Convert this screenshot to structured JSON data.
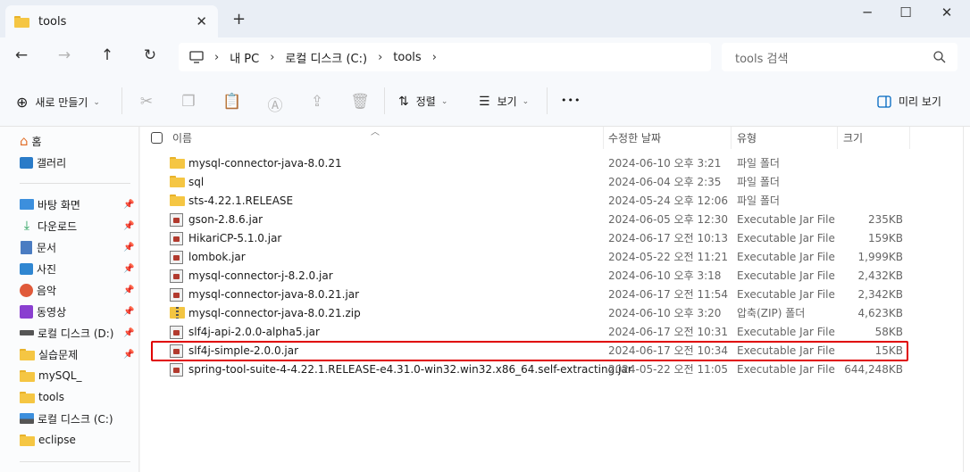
{
  "tab": {
    "title": "tools",
    "close": "✕",
    "new_tab": "+"
  },
  "window": {
    "minimize": "─",
    "maximize": "☐",
    "close": "✕"
  },
  "nav": {
    "breadcrumbs": [
      "내 PC",
      "로컬 디스크 (C:)",
      "tools"
    ],
    "search_placeholder": "tools 검색"
  },
  "commands": {
    "new": "새로 만들기",
    "sort": "정렬",
    "view": "보기",
    "more": "•••",
    "preview": "미리 보기"
  },
  "sidebar": {
    "top": [
      {
        "label": "홈",
        "icon": "home-icon"
      },
      {
        "label": "갤러리",
        "icon": "gallery-icon"
      }
    ],
    "quick": [
      {
        "label": "바탕 화면",
        "icon": "desktop-icon",
        "pinned": true
      },
      {
        "label": "다운로드",
        "icon": "download-icon",
        "pinned": true
      },
      {
        "label": "문서",
        "icon": "document-icon",
        "pinned": true
      },
      {
        "label": "사진",
        "icon": "pictures-icon",
        "pinned": true
      },
      {
        "label": "음악",
        "icon": "music-icon",
        "pinned": true
      },
      {
        "label": "동영상",
        "icon": "video-icon",
        "pinned": true
      },
      {
        "label": "로컬 디스크 (D:)",
        "icon": "drive-icon",
        "pinned": true
      },
      {
        "label": "실습문제",
        "icon": "folder-icon",
        "pinned": true
      },
      {
        "label": "mySQL_",
        "icon": "folder-icon",
        "pinned": false
      },
      {
        "label": "tools",
        "icon": "folder-icon",
        "pinned": false
      },
      {
        "label": "로컬 디스크 (C:)",
        "icon": "drive-icon",
        "pinned": false
      },
      {
        "label": "eclipse",
        "icon": "folder-icon",
        "pinned": false
      }
    ]
  },
  "columns": {
    "name": "이름",
    "modified": "수정한 날짜",
    "type": "유형",
    "size": "크기"
  },
  "files": [
    {
      "name": "mysql-connector-java-8.0.21",
      "date": "2024-06-10 오후 3:21",
      "type": "파일 폴더",
      "size": "",
      "kind": "folder"
    },
    {
      "name": "sql",
      "date": "2024-06-04 오후 2:35",
      "type": "파일 폴더",
      "size": "",
      "kind": "folder"
    },
    {
      "name": "sts-4.22.1.RELEASE",
      "date": "2024-05-24 오후 12:06",
      "type": "파일 폴더",
      "size": "",
      "kind": "folder"
    },
    {
      "name": "gson-2.8.6.jar",
      "date": "2024-06-05 오후 12:30",
      "type": "Executable Jar File",
      "size": "235KB",
      "kind": "jar"
    },
    {
      "name": "HikariCP-5.1.0.jar",
      "date": "2024-06-17 오전 10:13",
      "type": "Executable Jar File",
      "size": "159KB",
      "kind": "jar"
    },
    {
      "name": "lombok.jar",
      "date": "2024-05-22 오전 11:21",
      "type": "Executable Jar File",
      "size": "1,999KB",
      "kind": "jar"
    },
    {
      "name": "mysql-connector-j-8.2.0.jar",
      "date": "2024-06-10 오후 3:18",
      "type": "Executable Jar File",
      "size": "2,432KB",
      "kind": "jar"
    },
    {
      "name": "mysql-connector-java-8.0.21.jar",
      "date": "2024-06-17 오전 11:54",
      "type": "Executable Jar File",
      "size": "2,342KB",
      "kind": "jar"
    },
    {
      "name": "mysql-connector-java-8.0.21.zip",
      "date": "2024-06-10 오후 3:20",
      "type": "압축(ZIP) 폴더",
      "size": "4,623KB",
      "kind": "zip"
    },
    {
      "name": "slf4j-api-2.0.0-alpha5.jar",
      "date": "2024-06-17 오전 10:31",
      "type": "Executable Jar File",
      "size": "58KB",
      "kind": "jar"
    },
    {
      "name": "slf4j-simple-2.0.0.jar",
      "date": "2024-06-17 오전 10:34",
      "type": "Executable Jar File",
      "size": "15KB",
      "kind": "jar"
    },
    {
      "name": "spring-tool-suite-4-4.22.1.RELEASE-e4.31.0-win32.win32.x86_64.self-extracting.jar",
      "date": "2024-05-22 오전 11:05",
      "type": "Executable Jar File",
      "size": "644,248KB",
      "kind": "jar"
    }
  ],
  "colors": {
    "highlight": "#e00000",
    "folder": "#f5c643",
    "accent": "#0067c0"
  }
}
